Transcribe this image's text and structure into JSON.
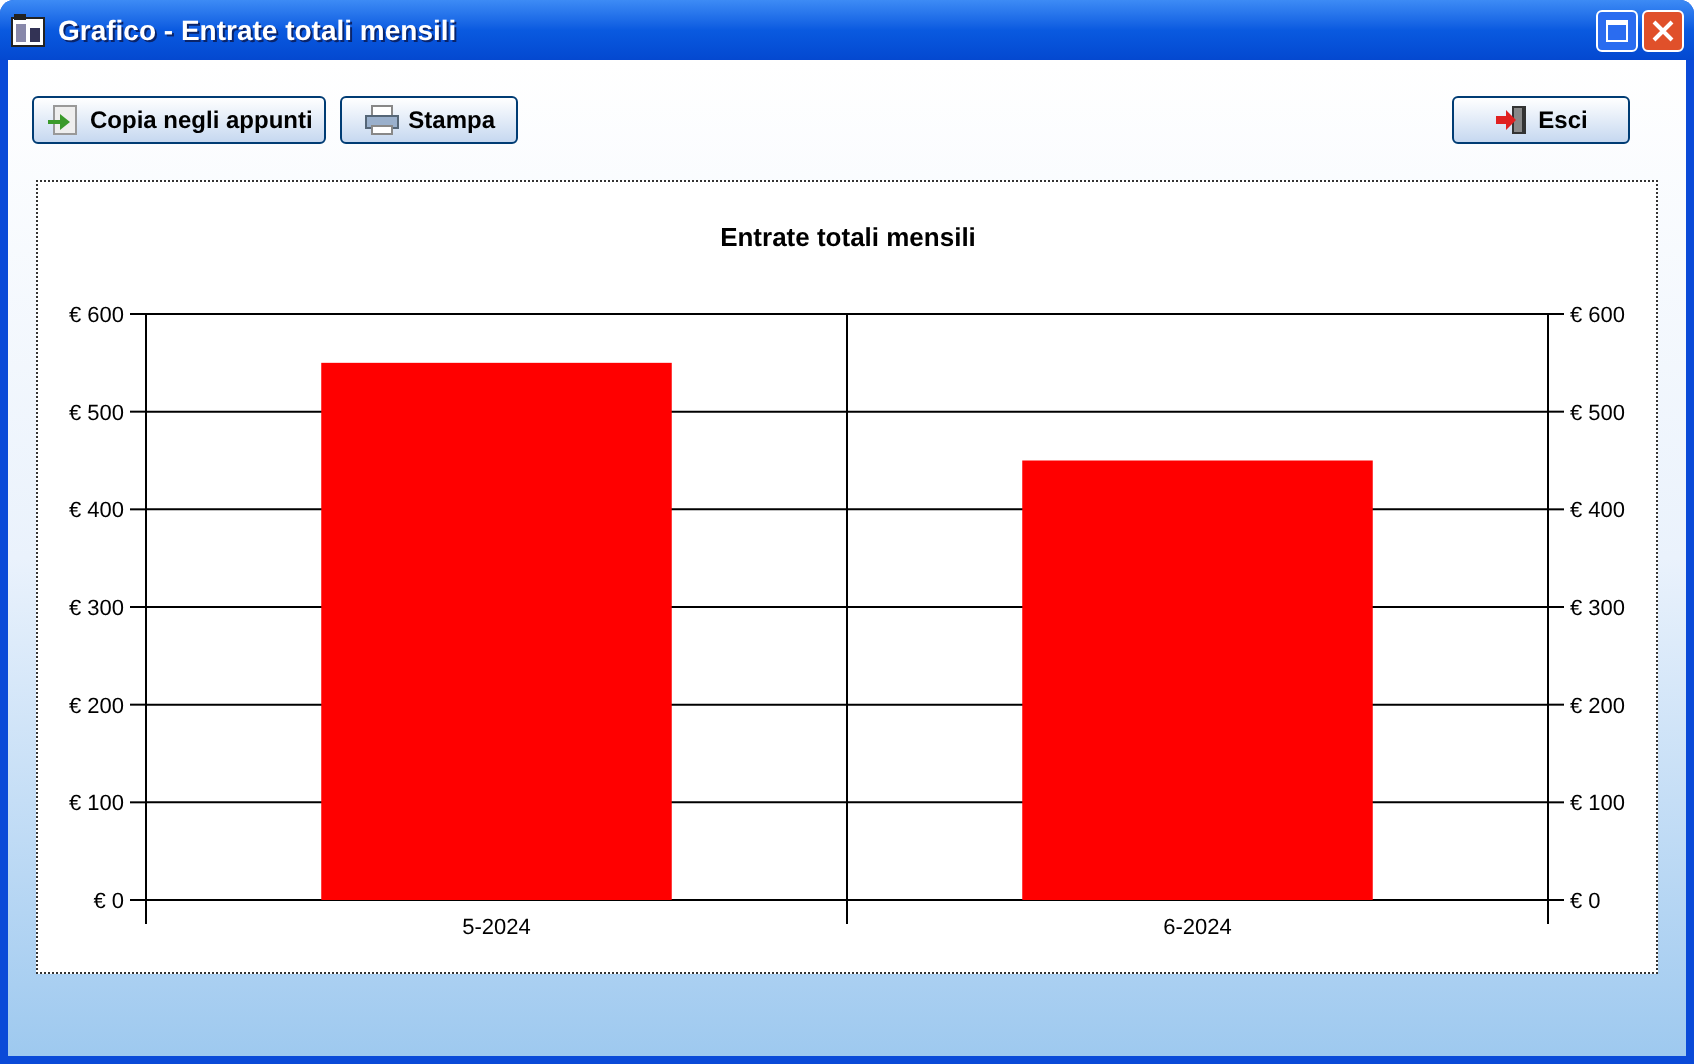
{
  "window": {
    "title": "Grafico - Entrate totali mensili"
  },
  "toolbar": [
    {
      "label": "Copia negli appunti",
      "kind": "copy"
    },
    {
      "label": "Stampa",
      "kind": "print"
    },
    {
      "label": "Esci",
      "kind": "exit"
    }
  ],
  "chart": {
    "chart_data": {
      "type": "bar",
      "title": "Entrate totali mensili",
      "categories": [
        "5-2024",
        "6-2024"
      ],
      "series": [
        {
          "color": "#ff0000",
          "values": [
            550,
            450
          ]
        }
      ],
      "grid": true,
      "ylim": [
        0,
        600
      ],
      "yticks": [
        {
          "value": 0,
          "label": "€ 0"
        },
        {
          "value": 100,
          "label": "€ 100"
        },
        {
          "value": 200,
          "label": "€ 200"
        },
        {
          "value": 300,
          "label": "€ 300"
        },
        {
          "value": 400,
          "label": "€ 400"
        },
        {
          "value": 500,
          "label": "€ 500"
        },
        {
          "value": 600,
          "label": "€ 600"
        }
      ]
    }
  }
}
